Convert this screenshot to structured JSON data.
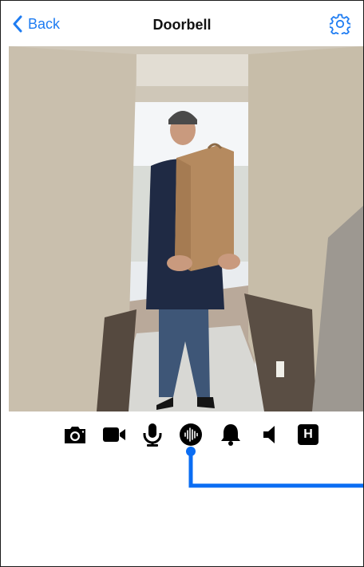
{
  "nav": {
    "back_label": "Back",
    "title": "Doorbell"
  },
  "icons": {
    "back": "chevron-left-icon",
    "settings": "gear-icon"
  },
  "toolbar": {
    "items": [
      {
        "name": "snapshot",
        "icon": "camera-icon"
      },
      {
        "name": "record",
        "icon": "video-camera-icon"
      },
      {
        "name": "microphone",
        "icon": "microphone-icon"
      },
      {
        "name": "voice",
        "icon": "sound-wave-icon"
      },
      {
        "name": "alerts",
        "icon": "bell-icon"
      },
      {
        "name": "speaker",
        "icon": "speaker-icon"
      },
      {
        "name": "hd",
        "icon": "hd-icon",
        "label": "H"
      }
    ]
  },
  "colors": {
    "accent": "#1e7cf2",
    "connector": "#0a6df3"
  }
}
